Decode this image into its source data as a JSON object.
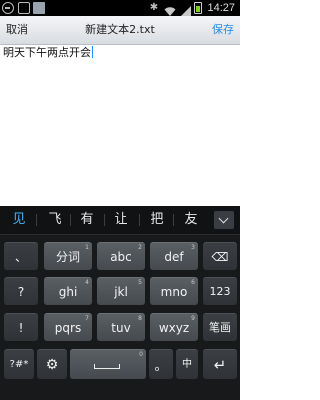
{
  "status_bar": {
    "time": "14:27",
    "icons": [
      "notification-icon",
      "gallery-icon",
      "image-icon",
      "bluetooth-icon",
      "wifi-icon",
      "signal-icon",
      "battery-icon"
    ],
    "battery_color": "#7ed321"
  },
  "title_bar": {
    "cancel_label": "取消",
    "title": "新建文本2.txt",
    "save_label": "保存",
    "save_color": "#2a8be0"
  },
  "editor": {
    "text": "明天下午两点开会",
    "caret_color": "#1e8fff"
  },
  "candidates": {
    "items": [
      "见",
      "飞",
      "有",
      "让",
      "把",
      "友"
    ],
    "highlight_color": "#3fb4ff",
    "expand_icon": "chevron-down-icon"
  },
  "keyboard": {
    "row1": [
      {
        "label": "、",
        "num": ""
      },
      {
        "label": "分词",
        "num": "1"
      },
      {
        "label": "abc",
        "num": "2"
      },
      {
        "label": "def",
        "num": "3"
      },
      {
        "label": "⌫",
        "num": ""
      }
    ],
    "row2": [
      {
        "label": "?",
        "num": ""
      },
      {
        "label": "ghi",
        "num": "4"
      },
      {
        "label": "jkl",
        "num": "5"
      },
      {
        "label": "mno",
        "num": "6"
      },
      {
        "label": "123",
        "num": ""
      }
    ],
    "row3": [
      {
        "label": "!",
        "num": ""
      },
      {
        "label": "pqrs",
        "num": "7"
      },
      {
        "label": "tuv",
        "num": "8"
      },
      {
        "label": "wxyz",
        "num": "9"
      },
      {
        "label": "笔画",
        "num": ""
      }
    ],
    "row4": {
      "symbols": "?#*",
      "settings": "⚙",
      "space_num": "0",
      "period": "。",
      "lang": "中",
      "enter": "↵"
    }
  }
}
